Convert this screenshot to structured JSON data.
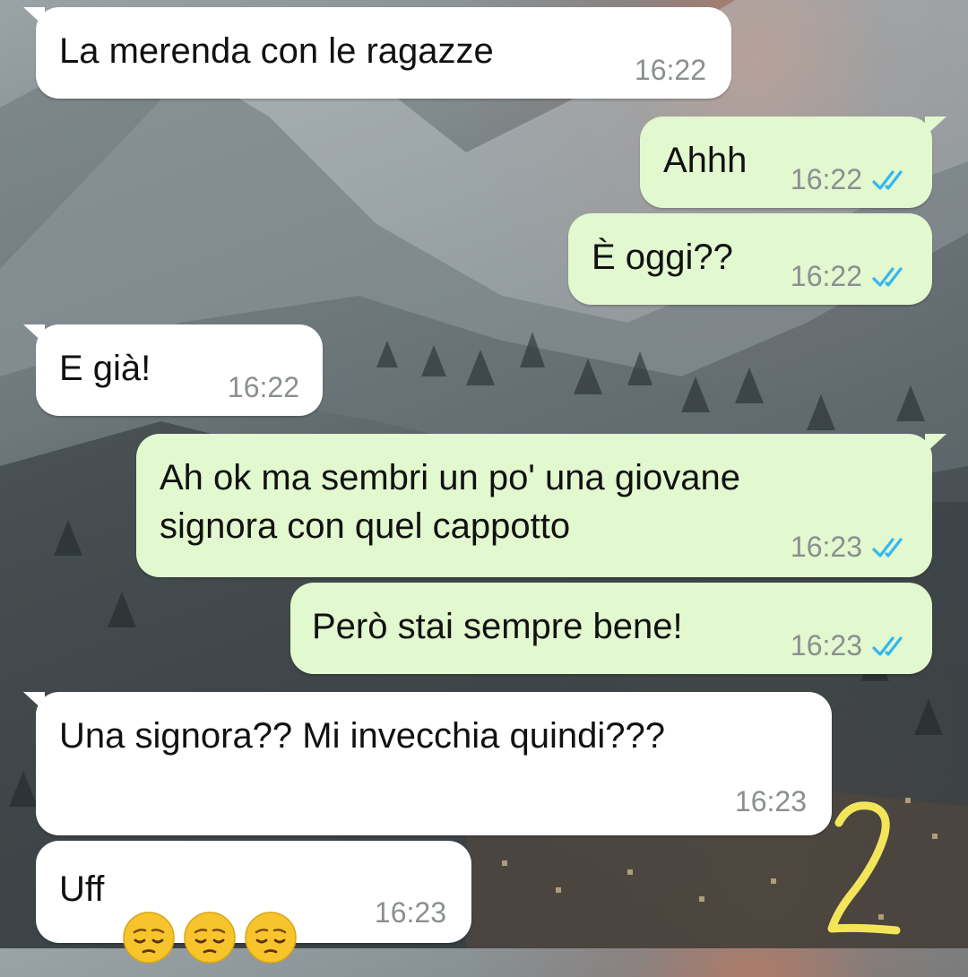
{
  "colors": {
    "incoming_bubble": "#ffffff",
    "outgoing_bubble": "#e2f8cf",
    "timestamp": "#8a8f90",
    "read_ticks": "#34b7f1",
    "emoji_face": "#f7c52b",
    "handwritten_mark": "#f2e55a"
  },
  "messages": [
    {
      "direction": "incoming",
      "text": "La merenda con le ragazze",
      "time": "16:22"
    },
    {
      "direction": "outgoing",
      "text": "Ahhh",
      "time": "16:22",
      "status": "read"
    },
    {
      "direction": "outgoing",
      "text": "È oggi??",
      "time": "16:22",
      "status": "read"
    },
    {
      "direction": "incoming",
      "text": "E già!",
      "time": "16:22"
    },
    {
      "direction": "outgoing",
      "text": "Ah ok ma sembri un po' una giovane\nsignora con quel cappotto",
      "time": "16:23",
      "status": "read"
    },
    {
      "direction": "outgoing",
      "text": "Però stai sempre bene!",
      "time": "16:23",
      "status": "read"
    },
    {
      "direction": "incoming",
      "text": "Una signora?? Mi invecchia quindi???",
      "time": "16:23"
    },
    {
      "direction": "incoming",
      "text": "Uff",
      "emoji": [
        "pensive-face-emoji",
        "pensive-face-emoji",
        "pensive-face-emoji"
      ],
      "time": "16:23"
    }
  ],
  "handwritten_mark": "2"
}
